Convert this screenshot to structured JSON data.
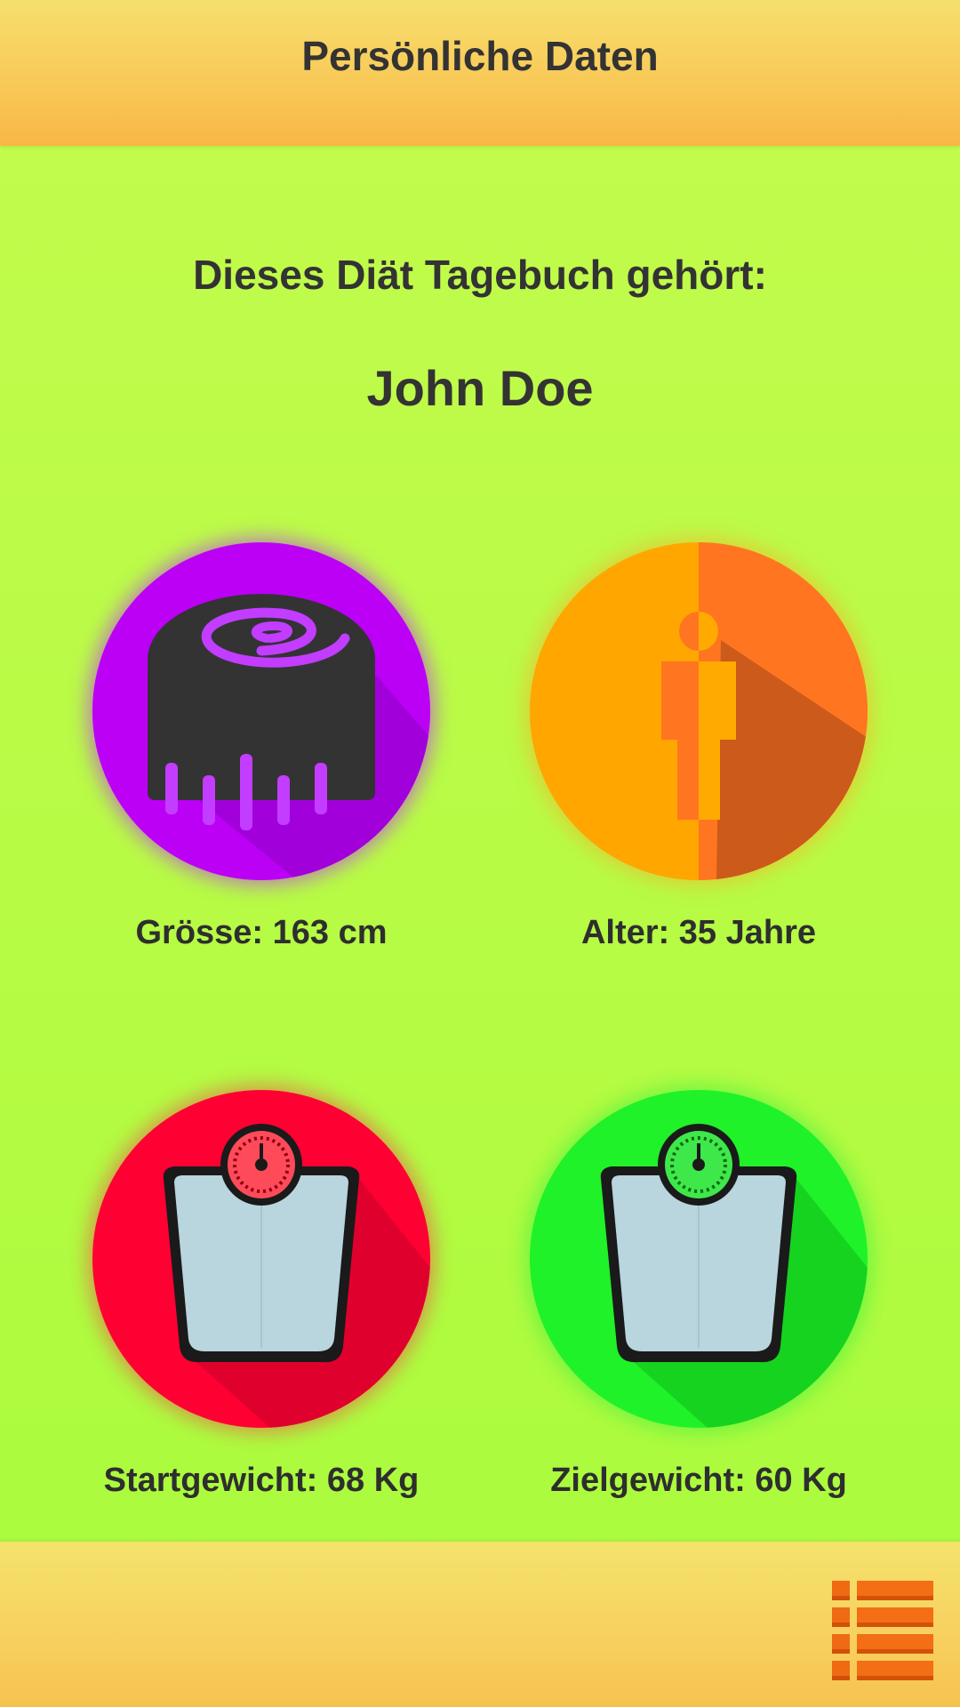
{
  "header": {
    "title": "Persönliche Daten"
  },
  "owner": {
    "label": "Dieses Diät Tagebuch gehört:",
    "name": "John Doe"
  },
  "stats": {
    "height": {
      "label": "Grösse: 163 cm",
      "icon": "measuring-tape-icon",
      "color": "#bb00f5"
    },
    "age": {
      "label": "Alter: 35 Jahre",
      "icon": "person-icon",
      "color": "#ffa600"
    },
    "start_weight": {
      "label": "Startgewicht: 68 Kg",
      "icon": "scale-icon",
      "color": "#ff0033"
    },
    "target_weight": {
      "label": "Zielgewicht: 60 Kg",
      "icon": "scale-icon",
      "color": "#1ff228"
    }
  },
  "footer": {
    "menu_icon": "list-menu-icon"
  }
}
